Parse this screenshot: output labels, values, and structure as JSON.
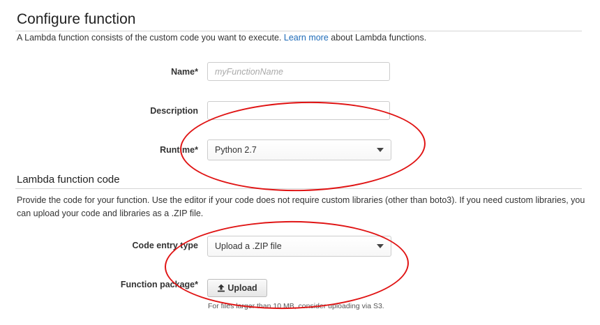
{
  "section": {
    "title": "Configure function",
    "intro_before_link": "A Lambda function consists of the custom code you want to execute. ",
    "intro_link": "Learn more",
    "intro_after_link": " about Lambda functions."
  },
  "form": {
    "name_label": "Name*",
    "name_placeholder": "myFunctionName",
    "name_value": "",
    "description_label": "Description",
    "description_value": "",
    "runtime_label": "Runtime*",
    "runtime_value": "Python 2.7"
  },
  "code_section": {
    "title": "Lambda function code",
    "description": "Provide the code for your function. Use the editor if your code does not require custom libraries (other than boto3). If you need custom libraries, you can upload your code and libraries as a .ZIP file.",
    "code_entry_type_label": "Code entry type",
    "code_entry_type_value": "Upload a .ZIP file",
    "function_package_label": "Function package*",
    "upload_button_label": "Upload",
    "upload_hint": "For files larger than 10 MB, consider uploading via S3."
  },
  "annotations": {
    "highlight_color": "#e01414"
  },
  "icons": {
    "upload": "upload-arrow-icon",
    "dropdown": "caret-down-icon"
  }
}
